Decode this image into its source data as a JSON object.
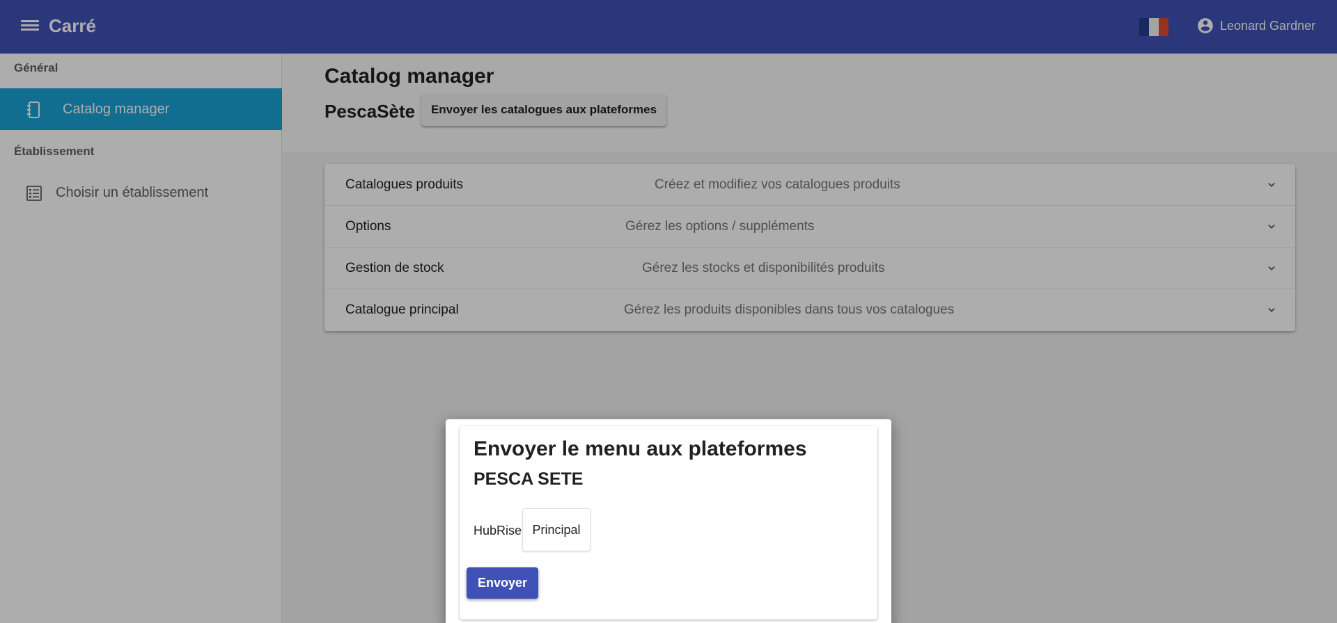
{
  "appbar": {
    "menu_icon": "menu-icon",
    "title": "Carré",
    "flag_icon": "france-flag-icon",
    "user_icon": "account-circle-icon",
    "user_name": "Leonard Gardner",
    "color": "#3f51b5"
  },
  "sidebar": {
    "sections": [
      {
        "title": "Général",
        "items": [
          {
            "label": "Catalog manager",
            "icon": "notebook-icon",
            "active": true
          }
        ]
      },
      {
        "title": "Établissement",
        "items": [
          {
            "label": "Choisir un établissement",
            "icon": "list-icon",
            "active": false
          }
        ]
      }
    ],
    "active_color": "#1ba2d6"
  },
  "main": {
    "page_title": "Catalog manager",
    "establishment": "PescaSète",
    "send_all_button": "Envoyer les catalogues aux plateformes",
    "accordion": [
      {
        "title": "Catalogues produits",
        "description": "Créez et modifiez vos catalogues produits"
      },
      {
        "title": "Options",
        "description": "Gérez les options / suppléments"
      },
      {
        "title": "Gestion de stock",
        "description": "Gérez les stocks et disponibilités produits"
      },
      {
        "title": "Catalogue principal",
        "description": "Gérez les produits disponibles dans tous vos catalogues"
      }
    ]
  },
  "dialog": {
    "title": "Envoyer le menu aux plateformes",
    "subtitle": "PESCA SETE",
    "platform_label": "HubRise",
    "platform_value": "Principal",
    "send_button": "Envoyer",
    "button_color": "#3f51b5"
  }
}
